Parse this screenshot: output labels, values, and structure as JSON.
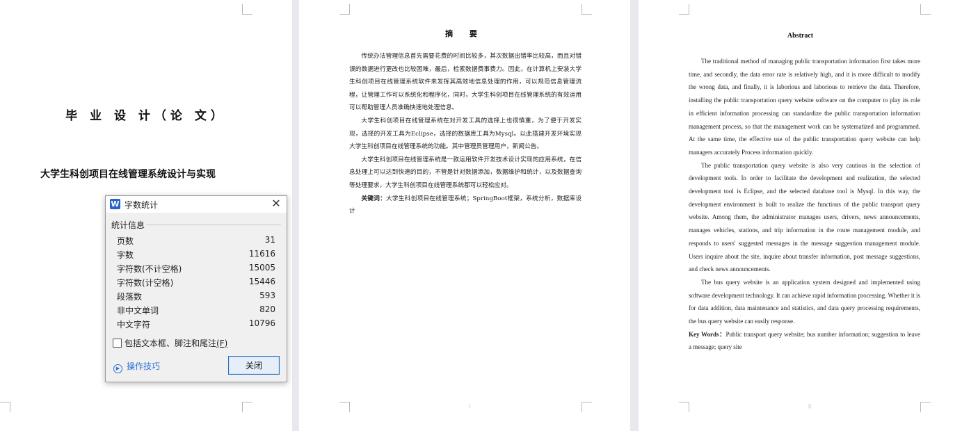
{
  "page1": {
    "cover_title": "毕 业 设 计（论 文）",
    "project_title": "大学生科创项目在线管理系统设计与实现"
  },
  "page2": {
    "heading": "摘  要",
    "paragraphs": [
      "传统办法管理信息首先需要花费的时间比较多，其次数据出错率比较高，而且对错误的数据进行更改也比较困难，最后，检索数据费事费力。因此，在计算机上安装大学生科创项目在线管理系统软件来发挥其高效地信息处理的作用，可以规范信息管理流程，让管理工作可以系统化和程序化，同时，大学生科创项目在线管理系统的有效运用可以帮助管理人员准确快速地处理信息。",
      "大学生科创项目在线管理系统在对开发工具的选择上也很慎重，为了便于开发实现，选择的开发工具为Eclipse，选择的数据库工具为Mysql。以此搭建开发环境实现大学生科创项目在线管理系统的功能。其中管理员管理用户，新闻公告。",
      "大学生科创项目在线管理系统是一款运用软件开发技术设计实现的应用系统，在信息处理上可以达到快速的目的，不管是针对数据添加，数据维护和统计，以及数据查询等处理要求，大学生科创项目在线管理系统都可以轻松应对。"
    ],
    "keywords_label": "关键词：",
    "keywords": "大学生科创项目在线管理系统；SpringBoot框架，系统分析，数据库设计"
  },
  "page3": {
    "heading": "Abstract",
    "paragraphs": [
      "The traditional method of managing public transportation information first takes more time, and secondly, the data error rate is relatively high, and it is more difficult to modify the wrong data, and finally, it is laborious and laborious to retrieve the data. Therefore, installing the public transportation query website software on the computer to play its role in efficient information processing can standardize the public transportation information management process, so that the management work can be systematized and programmed. At the same time, the effective use of the public transportation query website can help managers accurately Process information quickly.",
      "The public transportation query website is also very cautious in the selection of development tools. In order to facilitate the development and realization, the selected development tool is Eclipse, and the selected database tool is Mysql. In this way, the development environment is built to realize the functions of the public transport query website. Among them, the administrator manages users, drivers, news announcements, manages vehicles, stations, and trip information in the route management module, and responds to users' suggested messages in the message suggestion management module. Users inquire about the site, inquire about transfer information, post message suggestions, and check news announcements.",
      "The bus query website is an application system designed and implemented using software development technology. It can achieve rapid information processing. Whether it is for data addition, data maintenance and statistics, and data query processing requirements, the bus query website can easily response."
    ],
    "keywords_label": "Key Words：",
    "keywords": "Public transport query website; bus number information; suggestion to leave a message; query site"
  },
  "dialog": {
    "app_icon": "W",
    "title": "字数统计",
    "close_icon": "✕",
    "group_label": "统计信息",
    "stats": [
      {
        "label": "页数",
        "value": "31"
      },
      {
        "label": "字数",
        "value": "11616"
      },
      {
        "label": "字符数(不计空格)",
        "value": "15005"
      },
      {
        "label": "字符数(计空格)",
        "value": "15446"
      },
      {
        "label": "段落数",
        "value": "593"
      },
      {
        "label": "非中文单词",
        "value": "820"
      },
      {
        "label": "中文字符",
        "value": "10796"
      }
    ],
    "checkbox_label": "包括文本框、脚注和尾注",
    "checkbox_mnemonic": "(F)",
    "checkbox_checked": false,
    "tips_link": "操作技巧",
    "close_button": "关闭"
  }
}
